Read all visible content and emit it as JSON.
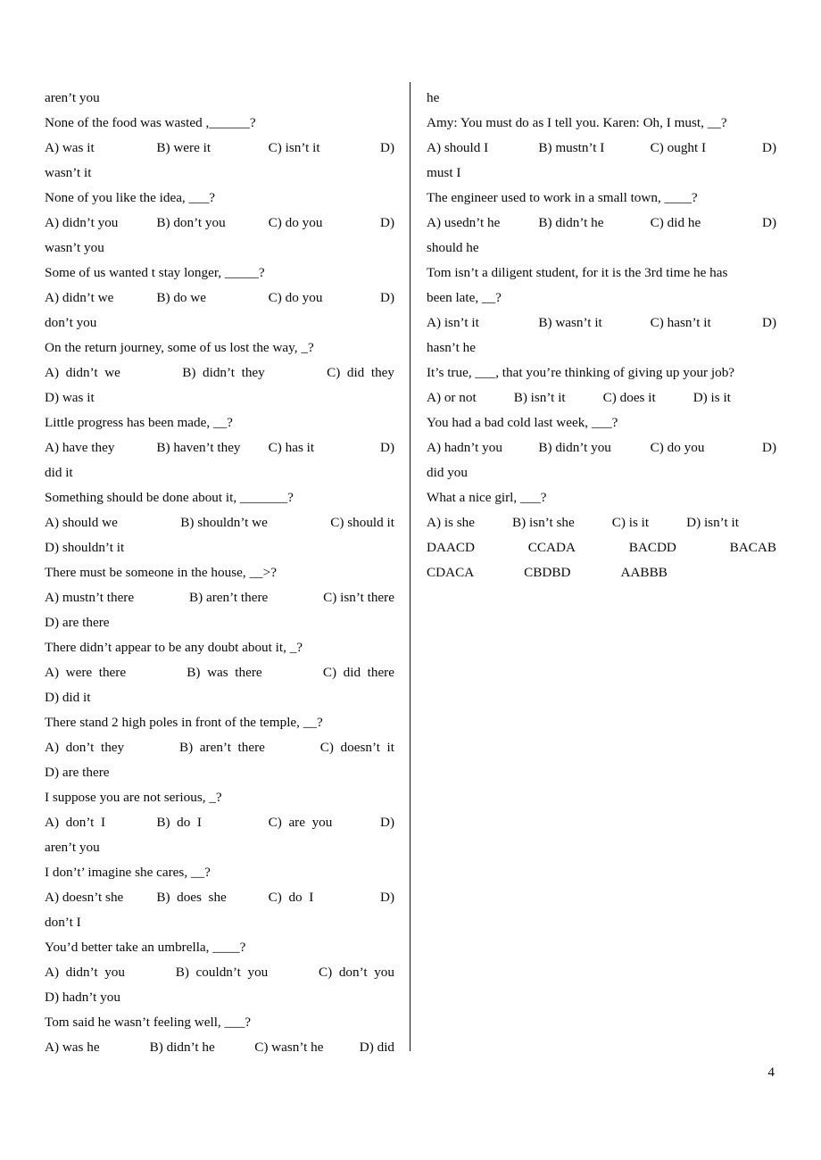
{
  "page": {
    "number": "4",
    "divider": true
  },
  "left_column": [
    {
      "type": "text",
      "text": "aren’t you"
    },
    {
      "type": "text",
      "text": "None of the food was wasted ,______?"
    },
    {
      "type": "options",
      "layout": "tabs",
      "items": [
        "A) was it",
        "B) were it",
        "C) isn’t it",
        "D)"
      ]
    },
    {
      "type": "text",
      "text": "wasn’t it"
    },
    {
      "type": "text",
      "text": "None of you like the idea, ___?"
    },
    {
      "type": "options",
      "layout": "tabs",
      "items": [
        "A) didn’t you",
        "B) don’t you",
        "C) do you",
        "D)"
      ]
    },
    {
      "type": "text",
      "text": "wasn’t you"
    },
    {
      "type": "text",
      "text": "Some of us wanted t stay longer, _____?"
    },
    {
      "type": "options",
      "layout": "tabs",
      "items": [
        "A) didn’t we",
        "B) do we",
        "C) do you",
        "D)"
      ]
    },
    {
      "type": "text",
      "text": "don’t you"
    },
    {
      "type": "text",
      "text": "On the return journey, some of us lost the way, _?"
    },
    {
      "type": "options",
      "layout": "spread",
      "items": [
        "A)  didn’t  we",
        "B)  didn’t  they",
        "C)  did  they"
      ]
    },
    {
      "type": "text",
      "text": "D) was it"
    },
    {
      "type": "text",
      "text": "Little progress has been made, __?"
    },
    {
      "type": "options",
      "layout": "tabs",
      "items": [
        "A) have they",
        "B) haven’t they",
        "C) has it",
        "D)"
      ]
    },
    {
      "type": "text",
      "text": "did it"
    },
    {
      "type": "text",
      "text": "Something should be done about it, _______?"
    },
    {
      "type": "options",
      "layout": "spread",
      "items": [
        "A) should we",
        "B) shouldn’t we",
        "C) should it"
      ]
    },
    {
      "type": "text",
      "text": "D) shouldn’t it"
    },
    {
      "type": "text",
      "text": "There must be someone in the house, __>?"
    },
    {
      "type": "options",
      "layout": "spread",
      "items": [
        "A) mustn’t there",
        "B) aren’t there",
        "C) isn’t there"
      ]
    },
    {
      "type": "text",
      "text": "D) are there"
    },
    {
      "type": "text",
      "text": "There didn’t appear to be any doubt about it, _?"
    },
    {
      "type": "options",
      "layout": "spread",
      "items": [
        "A)  were  there",
        "B)  was  there",
        "C)  did  there"
      ]
    },
    {
      "type": "text",
      "text": "D) did it"
    },
    {
      "type": "text",
      "text": "There stand 2 high poles in front of the temple, __?"
    },
    {
      "type": "options",
      "layout": "spread",
      "items": [
        "A)  don’t  they",
        "B)  aren’t  there",
        "C)  doesn’t  it"
      ]
    },
    {
      "type": "text",
      "text": "D) are there"
    },
    {
      "type": "text",
      "text": "I suppose you are not serious, _?"
    },
    {
      "type": "options",
      "layout": "tabs",
      "items": [
        "A)  don’t  I",
        "B)  do  I",
        "C)  are  you",
        "D)"
      ]
    },
    {
      "type": "text",
      "text": "aren’t you"
    },
    {
      "type": "text",
      "text": "I don’t’ imagine she cares, __?"
    },
    {
      "type": "options",
      "layout": "tabs",
      "items": [
        "A) doesn’t she",
        "B)  does  she",
        "C)  do  I",
        "D)"
      ]
    },
    {
      "type": "text",
      "text": "don’t I"
    },
    {
      "type": "text",
      "text": "You’d better take an umbrella, ____?"
    },
    {
      "type": "options",
      "layout": "spread",
      "items": [
        "A)  didn’t  you",
        "B)  couldn’t  you",
        "C)  don’t  you"
      ]
    },
    {
      "type": "text",
      "text": "D) hadn’t you"
    },
    {
      "type": "text",
      "text": "Tom said he wasn’t feeling well, ___?"
    },
    {
      "type": "options",
      "layout": "tabs",
      "items": [
        "A) was he",
        "B) didn’t he",
        "C) wasn’t he",
        "D) did"
      ]
    }
  ],
  "right_column": [
    {
      "type": "text",
      "text": "he"
    },
    {
      "type": "text",
      "text": "Amy: You must do as I tell you. Karen: Oh, I must, __?"
    },
    {
      "type": "options",
      "layout": "tabs",
      "items": [
        "A) should I",
        "B) mustn’t I",
        "C) ought I",
        "D)"
      ]
    },
    {
      "type": "text",
      "text": "must I"
    },
    {
      "type": "text",
      "text": "The engineer used to work in a small town, ____?"
    },
    {
      "type": "options",
      "layout": "tabs",
      "items": [
        "A) usedn’t he",
        "B) didn’t he",
        "C) did he",
        "D)"
      ]
    },
    {
      "type": "text",
      "text": "should he"
    },
    {
      "type": "justified",
      "text": "Tom isn’t a diligent student, for it is the 3rd time he has"
    },
    {
      "type": "text",
      "text": "been late, __?"
    },
    {
      "type": "options",
      "layout": "tabs",
      "items": [
        "A) isn’t it",
        "B) wasn’t it",
        "C) hasn’t it",
        "D)"
      ]
    },
    {
      "type": "text",
      "text": "hasn’t he"
    },
    {
      "type": "text",
      "text": "It’s true, ___, that you’re thinking of giving up your job?"
    },
    {
      "type": "options",
      "layout": "left",
      "items": [
        "A) or not",
        "B) isn’t it",
        "C) does it",
        "D) is it"
      ]
    },
    {
      "type": "text",
      "text": "You had a bad cold last week, ___?"
    },
    {
      "type": "options",
      "layout": "tabs",
      "items": [
        "A) hadn’t you",
        "B) didn’t you",
        "C) do you",
        "D)"
      ]
    },
    {
      "type": "text",
      "text": "did you"
    },
    {
      "type": "text",
      "text": "What a nice girl, ___?"
    },
    {
      "type": "options",
      "layout": "left",
      "items": [
        "A) is she",
        "B) isn’t she",
        "C) is it",
        "D) isn’t it"
      ]
    }
  ],
  "answer_key": {
    "rows": [
      {
        "layout": "spread",
        "codes": [
          "DAACD",
          "CCADA",
          "BACDD",
          "BACAB"
        ]
      },
      {
        "layout": "left",
        "codes": [
          "CDACA",
          "CBDBD",
          "AABBB"
        ]
      }
    ]
  }
}
